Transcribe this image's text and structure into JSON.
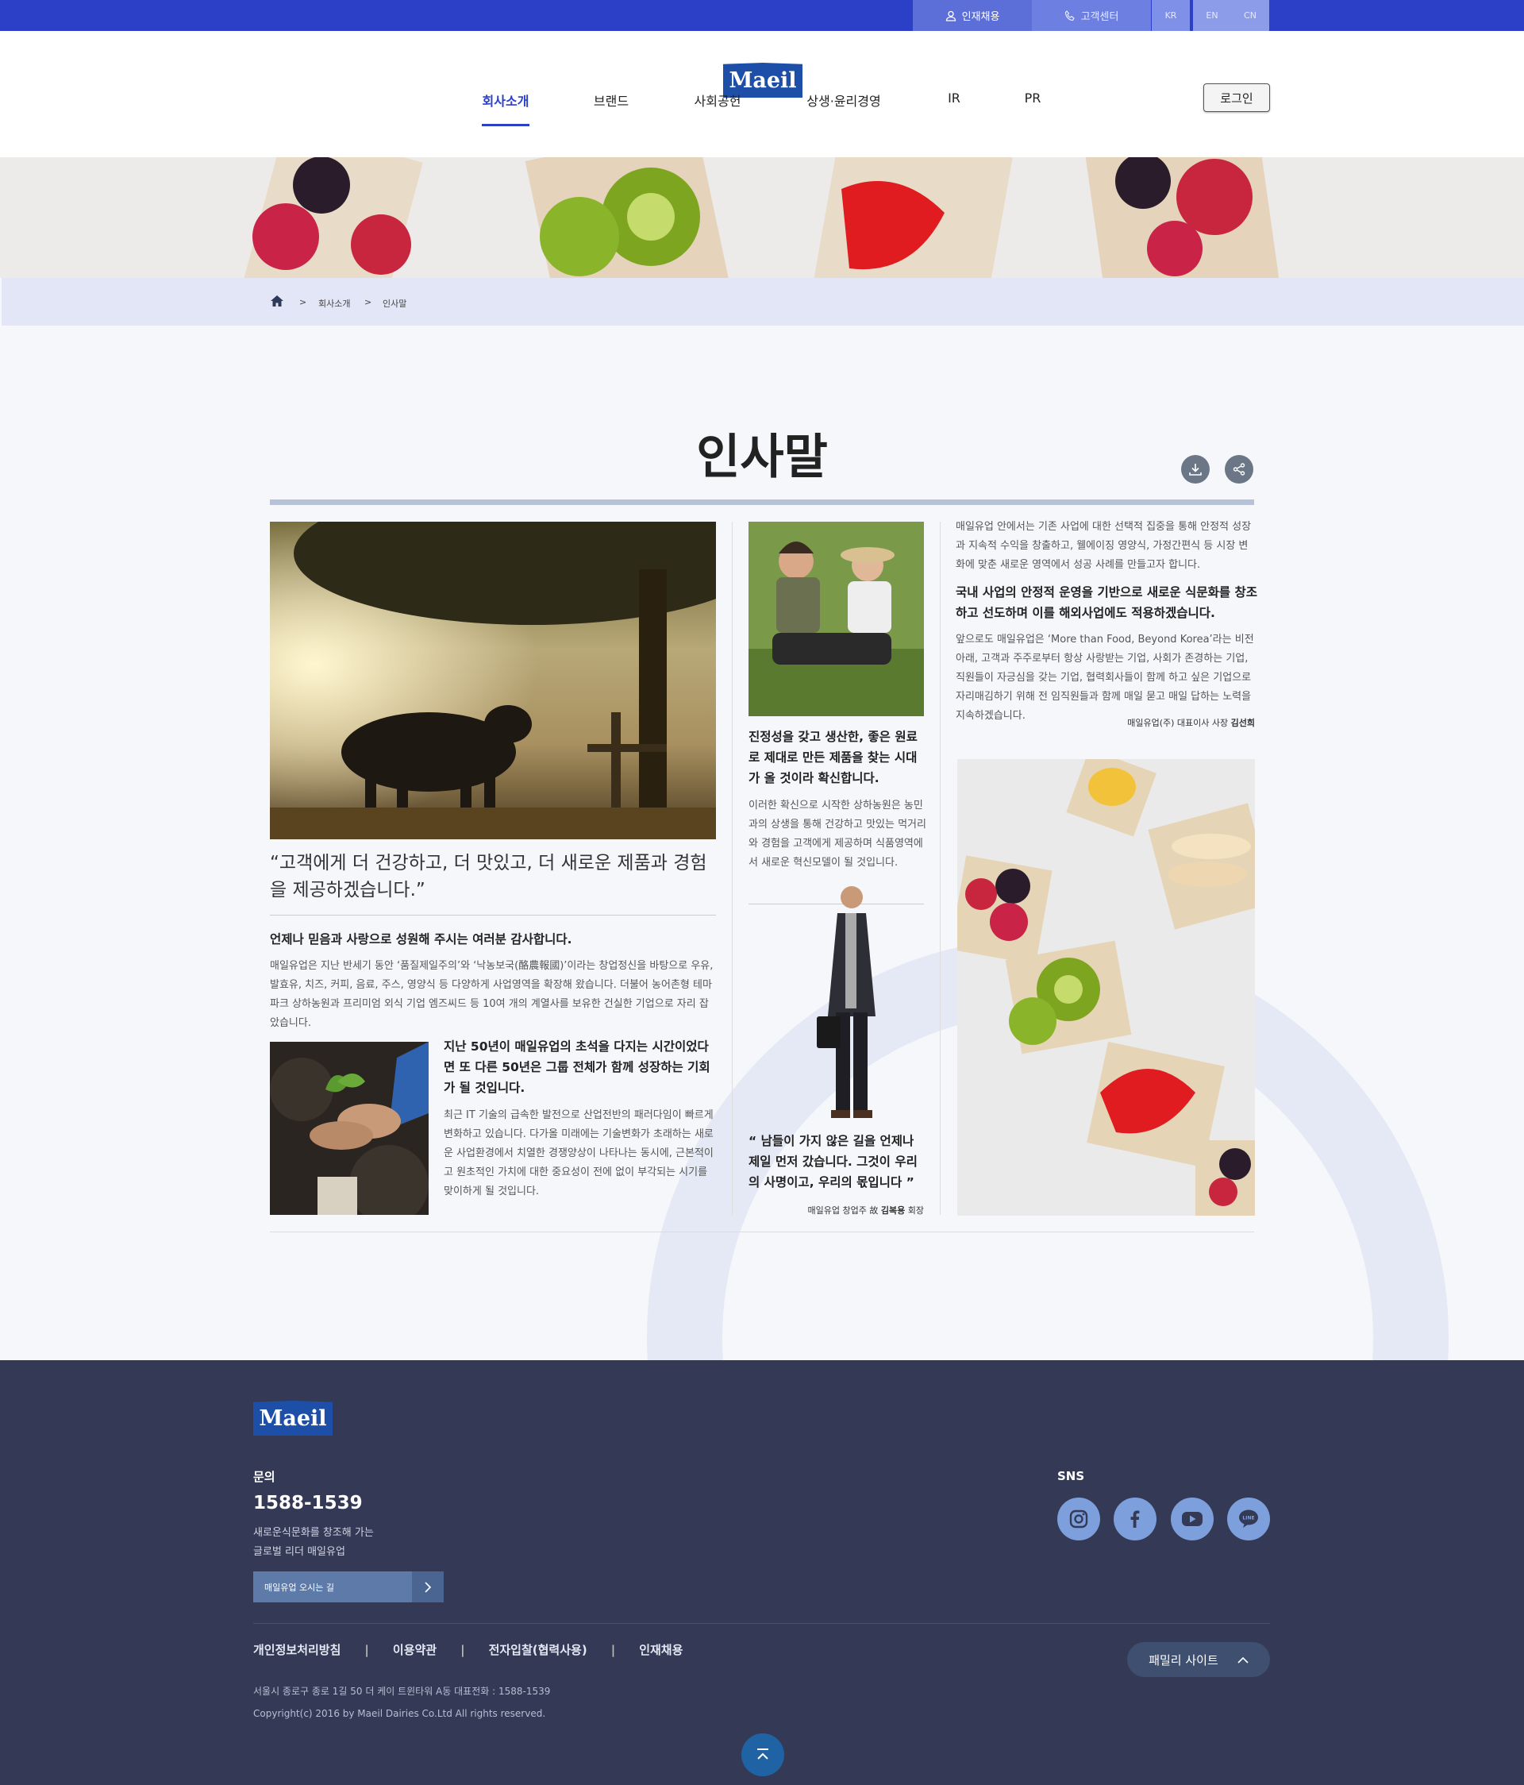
{
  "topbar": {
    "recruit": "인재채용",
    "customer_center": "고객센터",
    "languages": [
      "KR",
      "EN",
      "CN"
    ]
  },
  "header": {
    "logo_text": "Maeil",
    "nav": [
      "회사소개",
      "브랜드",
      "사회공헌",
      "상생·윤리경영",
      "IR",
      "PR"
    ],
    "active_nav": "회사소개",
    "login": "로그인"
  },
  "breadcrumb": [
    "회사소개",
    "인사말"
  ],
  "page_title": "인사말",
  "col1": {
    "quote": "“고객에게 더 건강하고, 더 맛있고, 더 새로운 제품과 경험을 제공하겠습니다.”",
    "heading": "언제나 믿음과 사랑으로 성원해 주시는 여러분 감사합니다.",
    "body": "매일유업은 지난 반세기 동안 ‘품질제일주의’와 ‘낙농보국(酪農報國)’이라는 창업정신을 바탕으로 우유, 발효유, 치즈, 커피, 음료, 주스, 영양식 등 다양하게 사업영역을 확장해 왔습니다. 더불어 농어촌형 테마파크 상하농원과 프리미엄 외식 기업 엠즈씨드 등 10여 개의 계열사를 보유한 건실한 기업으로 자리 잡았습니다.",
    "sub_heading": "지난 50년이 매일유업의 초석을 다지는 시간이었다면 또 다른 50년은 그룹 전체가 함께 성장하는 기회가 될 것입니다.",
    "sub_body": "최근 IT 기술의 급속한 발전으로 산업전반의 패러다임이 빠르게 변화하고 있습니다. 다가올 미래에는 기술변화가 초래하는 새로운 사업환경에서 치열한 경쟁양상이 나타나는 동시에, 근본적이고 원초적인 가치에 대한 중요성이 전에 없이 부각되는 시기를 맞이하게 될 것입니다."
  },
  "col2": {
    "heading": "진정성을 갖고 생산한, 좋은 원료로 제대로 만든 제품을 찾는 시대가 올 것이라 확신합니다.",
    "body": "이러한 확신으로 시작한 상하농원은 농민과의 상생을 통해 건강하고 맛있는 먹거리와 경험을 고객에게 제공하며 식품영역에서 새로운 혁신모델이 될 것입니다.",
    "quote": "“ 남들이 가지 않은 길을 언제나 제일 먼저 갔습니다. 그것이 우리의 사명이고, 우리의 몫입니다 ”",
    "quote_attr_prefix": "매일유업 창업주 故 ",
    "quote_attr_name": "김복용",
    "quote_attr_suffix": " 회장"
  },
  "col3": {
    "body1": "매일유업 안에서는 기존 사업에 대한 선택적 집중을 통해 안정적 성장과 지속적 수익을 창출하고, 웰에이징 영양식, 가정간편식 등 시장 변화에 맞춘 새로운 영역에서 성공 사례를 만들고자 합니다.",
    "heading": "국내 사업의 안정적 운영을 기반으로 새로운 식문화를 창조하고 선도하며 이를 해외사업에도 적용하겠습니다.",
    "body2": "앞으로도 매일유업은 ‘More than Food, Beyond Korea’라는 비전아래, 고객과 주주로부터 항상 사랑받는 기업, 사회가 존경하는 기업, 직원들이 자긍심을 갖는 기업, 협력회사들이 함께 하고 싶은 기업으로 자리매김하기 위해 전 임직원들과 함께 매일 묻고 매일 답하는 노력을 지속하겠습니다.",
    "sign_prefix": "매일유업(주) 대표이사 사장 ",
    "sign_name": "김선희"
  },
  "footer": {
    "logo_text": "Maeil",
    "contact_label": "문의",
    "phone": "1588-1539",
    "slogan_line1": "새로운식문화를 창조해 가는",
    "slogan_line2": "글로벌 리더 매일유업",
    "directions": "매일유업 오시는 길",
    "sns_label": "SNS",
    "links": [
      "개인정보처리방침",
      "이용약관",
      "전자입찰(협력사용)",
      "인재채용"
    ],
    "family_site": "패밀리 사이트",
    "address": "서울시 종로구 종로 1길 50 더 케이 트윈타워 A동 대표전화 : 1588-1539",
    "copyright": "Copyright(c) 2016 by Maeil Dairies Co.Ltd All rights reserved."
  }
}
